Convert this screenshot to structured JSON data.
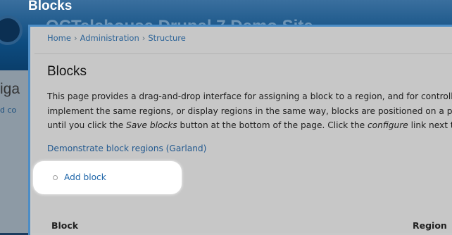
{
  "background": {
    "title": "Blocks",
    "site_name": "OCTelehouse Drupal 7 Demo Site",
    "partial_heading": "iga",
    "partial_text": "d co"
  },
  "breadcrumb": {
    "items": [
      "Home",
      "Administration",
      "Structure"
    ],
    "separator": "›"
  },
  "page": {
    "title": "Blocks",
    "description_line1": "This page provides a drag-and-drop interface for assigning a block to a region, and for controlling",
    "description_line2": "implement the same regions, or display regions in the same way, blocks are positioned on a per-",
    "description_line3_a": "until you click the ",
    "description_line3_em1": "Save blocks",
    "description_line3_b": " button at the bottom of the page. Click the ",
    "description_line3_em2": "configure",
    "description_line3_c": " link next to",
    "demo_link": "Demonstrate block regions (Garland)",
    "add_block": "Add block"
  },
  "table": {
    "headers": [
      "Block",
      "Region"
    ]
  },
  "colors": {
    "link": "#22598f",
    "frame_border": "#4c8dc6"
  }
}
